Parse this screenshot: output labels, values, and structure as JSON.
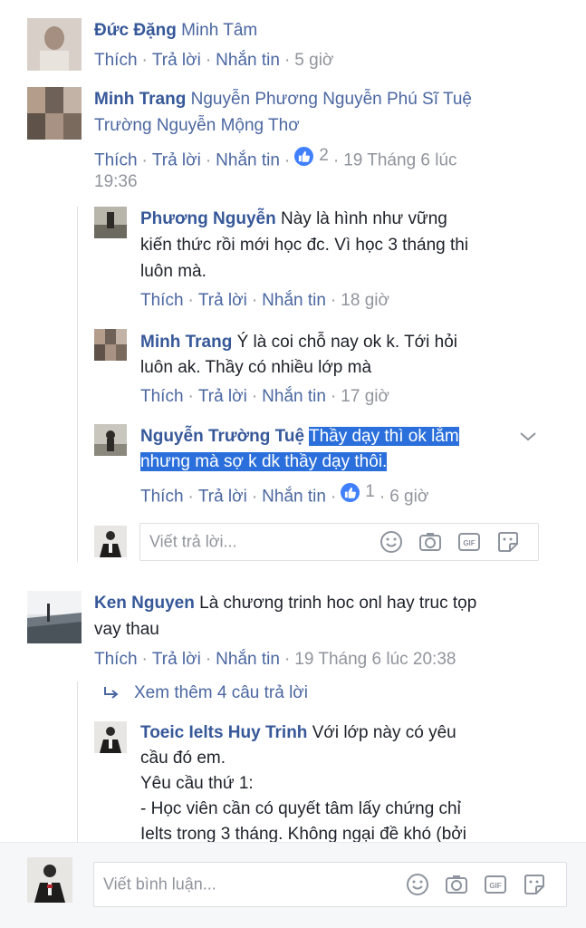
{
  "comments": [
    {
      "name": "Đức Đặng",
      "text_lines": [
        "Minh Tâm"
      ],
      "actions": {
        "like": "Thích",
        "reply": "Trả lời",
        "message": "Nhắn tin"
      },
      "time": "5 giờ"
    },
    {
      "name": "Minh Trang",
      "text_lines": [
        "Nguyễn Phương Nguyễn Phú Sĩ Tuệ",
        "Trường Nguyễn Mộng Thơ"
      ],
      "actions": {
        "like": "Thích",
        "reply": "Trả lời",
        "message": "Nhắn tin"
      },
      "like_count": "2",
      "time": "19 Tháng 6 lúc",
      "time_cont": "19:36"
    },
    {
      "name": "Ken Nguyen",
      "text_lines": [
        "Là chương trinh hoc onl hay truc tọp",
        "vay thau"
      ],
      "actions": {
        "like": "Thích",
        "reply": "Trả lời",
        "message": "Nhắn tin"
      },
      "time": "19 Tháng 6 lúc 20:38"
    }
  ],
  "replies": [
    {
      "name": "Phương Nguyễn",
      "text_lines": [
        "Này là hình như vững",
        "kiến thức rồi mới học đc. Vì học 3 tháng thi",
        "luôn mà."
      ],
      "actions": {
        "like": "Thích",
        "reply": "Trả lời",
        "message": "Nhắn tin"
      },
      "time": "18 giờ"
    },
    {
      "name": "Minh Trang",
      "text_lines": [
        "Ý là coi chỗ nay ok k. Tới hỏi",
        "luôn ak. Thầy có nhiều lớp mà"
      ],
      "actions": {
        "like": "Thích",
        "reply": "Trả lời",
        "message": "Nhắn tin"
      },
      "time": "17 giờ"
    },
    {
      "name": "Nguyễn Trường Tuệ",
      "text_lines": [
        "Thầy dạy thì ok lắm",
        "nhưng mà sợ k dk thầy dạy thôi."
      ],
      "actions": {
        "like": "Thích",
        "reply": "Trả lời",
        "message": "Nhắn tin"
      },
      "like_count": "1",
      "time": "6 giờ"
    },
    {
      "name": "Toeic Ielts Huy Trinh",
      "text_lines": [
        "Với lớp này có yêu",
        "cầu đó em.",
        "Yêu cầu thứ 1:",
        "- Học viên cần có quyết tâm lấy chứng chỉ",
        "Ielts trong 3 tháng. Không ngại đề khó (bởi"
      ]
    }
  ],
  "reply_input": {
    "placeholder": "Viết trả lời..."
  },
  "see_more": "Xem thêm 4 câu trả lời",
  "comment_input": {
    "placeholder": "Viết bình luận..."
  },
  "icons": [
    "emoji-icon",
    "camera-icon",
    "gif-icon",
    "sticker-icon"
  ],
  "colors": {
    "name": "#365899",
    "link": "#4b67a1",
    "meta": "#90949c",
    "highlight": "#2a6fdb",
    "like": "#4080ff"
  }
}
